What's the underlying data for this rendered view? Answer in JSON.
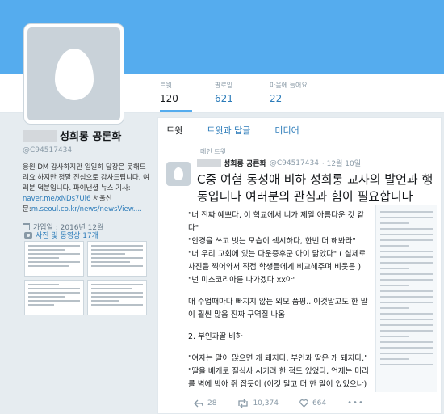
{
  "colors": {
    "brand": "#55acee",
    "link": "#2b7bb9",
    "muted": "#8899a6",
    "banner": "#55acee"
  },
  "stats": [
    {
      "label": "트윗",
      "value": "120"
    },
    {
      "label": "팔로잉",
      "value": "621"
    },
    {
      "label": "마음에 들어요",
      "value": "22"
    }
  ],
  "profile": {
    "name": "성희롱 공론화",
    "handle": "@C94517434",
    "bio_text": "응원 DM 감사하지만 일일히 답장은 못해드려요 하지만 정말 진심으로 감사드립니다. 여러분 덕분입니다. 파이낸셜 뉴스 기사: ",
    "bio_link1": "naver.me/xNDs7Ul6",
    "bio_mid": " 서울신문:",
    "bio_link2": "m.seoul.co.kr/news/newsView....",
    "joined": "가입일 : 2016년 12월"
  },
  "media": {
    "heading": "사진 및 동영상 17개"
  },
  "tabs": [
    "트윗",
    "트윗과 답글",
    "미디어"
  ],
  "tweet": {
    "pinned": "메인 트윗",
    "name": "성희롱 공론화",
    "handle": "@C94517434",
    "date": "· 12월 10일",
    "text": "C중 여혐 동성애 비하 성희롱 교사의 발언과 행동입니다 여러분의 관심과 힘이 필요합니다"
  },
  "card": {
    "lines": [
      "\"너 진짜 예쁘다, 이 학교에서 니가 제일 아름다운 것 같다\"",
      "\"안경을 쓰고 벗는 모습이 섹시하다, 한번 더 해봐라\"",
      "\"너 우리 교회에 있는 다운증후군 아이 닮았다\" ( 실제로 사진을 찍어와서 직접 학생들에게 비교해주며 비웃음 )",
      "\"넌 미스코리아를 나가겠다 xx아\"",
      "",
      "매 수업때마다 빠지지 않는 외모 품평.. 이것말고도 한 말이 훨씬 많음 진짜 구역질 나옴",
      "",
      "2. 부인과딸 비하",
      "",
      "\"여자는 말이 많으면 개 돼지다, 부인과 딸은 개 돼지다.\"",
      "\"딸을 베개로 질식사 시키려 한 적도 있었다, 언제는 머리를 벽에 박아 쥐 잡듯이 (이것 말고 더 한 말이 있었으나)"
    ]
  },
  "actions": {
    "replies": "28",
    "retweets": "10,374",
    "likes": "664",
    "more": "•••"
  }
}
